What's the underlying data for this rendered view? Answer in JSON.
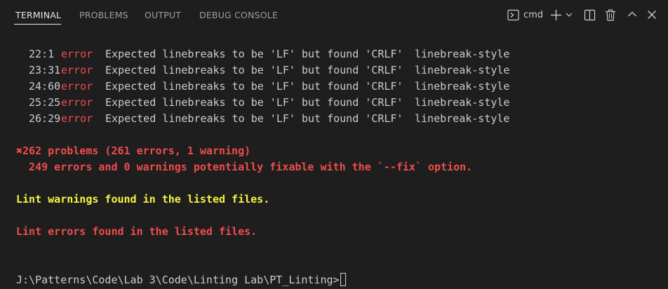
{
  "tabs": [
    {
      "label": "TERMINAL",
      "active": true
    },
    {
      "label": "PROBLEMS",
      "active": false
    },
    {
      "label": "OUTPUT",
      "active": false
    },
    {
      "label": "DEBUG CONSOLE",
      "active": false
    }
  ],
  "toolbar": {
    "shell_label": "cmd",
    "icons": [
      "terminal-icon",
      "plus-icon",
      "chevron-down-icon",
      "split-icon",
      "trash-icon",
      "chevron-up-icon",
      "close-icon"
    ]
  },
  "lint_rows": [
    {
      "location": "22:1",
      "severity": "error",
      "message": "Expected linebreaks to be 'LF' but found 'CRLF'",
      "rule": "linebreak-style"
    },
    {
      "location": "23:31",
      "severity": "error",
      "message": "Expected linebreaks to be 'LF' but found 'CRLF'",
      "rule": "linebreak-style"
    },
    {
      "location": "24:60",
      "severity": "error",
      "message": "Expected linebreaks to be 'LF' but found 'CRLF'",
      "rule": "linebreak-style"
    },
    {
      "location": "25:25",
      "severity": "error",
      "message": "Expected linebreaks to be 'LF' but found 'CRLF'",
      "rule": "linebreak-style"
    },
    {
      "location": "26:29",
      "severity": "error",
      "message": "Expected linebreaks to be 'LF' but found 'CRLF'",
      "rule": "linebreak-style"
    }
  ],
  "summary": {
    "problems": "✖262 problems (261 errors, 1 warning)",
    "fixable": "  249 errors and 0 warnings potentially fixable with the `--fix` option."
  },
  "messages": {
    "warnings": "Lint warnings found in the listed files.",
    "errors": "Lint errors found in the listed files."
  },
  "prompt": "J:\\Patterns\\Code\\Lab 3\\Code\\Linting Lab\\PT_Linting>",
  "colors": {
    "background": "#1e1e1e",
    "error_red": "#f14c4c",
    "warning_yellow": "#f5f543",
    "text": "#cccccc",
    "inactive_tab": "#9d9d9d"
  }
}
